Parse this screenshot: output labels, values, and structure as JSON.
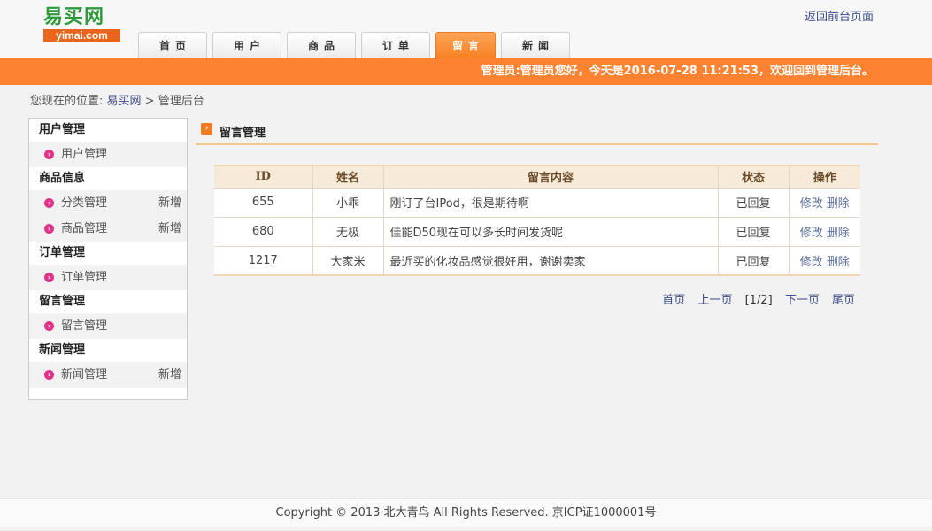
{
  "header": {
    "logo_cn": "易买网",
    "logo_en": "yimai.com",
    "back_link": "返回前台页面",
    "nav": [
      {
        "label": "首页"
      },
      {
        "label": "用户"
      },
      {
        "label": "商品"
      },
      {
        "label": "订单"
      },
      {
        "label": "留言",
        "active": true
      },
      {
        "label": "新闻"
      }
    ],
    "welcome": "管理员:管理员您好，今天是2016-07-28 11:21:53，欢迎回到管理后台。"
  },
  "breadcrumb": {
    "prefix": "您现在的位置:",
    "site": "易买网",
    "separator": ">",
    "current": "管理后台"
  },
  "sidebar": {
    "groups": [
      {
        "title": "用户管理",
        "items": [
          {
            "label": "用户管理",
            "add": ""
          }
        ]
      },
      {
        "title": "商品信息",
        "items": [
          {
            "label": "分类管理",
            "add": "新增"
          },
          {
            "label": "商品管理",
            "add": "新增"
          }
        ]
      },
      {
        "title": "订单管理",
        "items": [
          {
            "label": "订单管理",
            "add": ""
          }
        ]
      },
      {
        "title": "留言管理",
        "items": [
          {
            "label": "留言管理",
            "add": ""
          }
        ]
      },
      {
        "title": "新闻管理",
        "items": [
          {
            "label": "新闻管理",
            "add": "新增"
          }
        ]
      }
    ]
  },
  "main": {
    "title": "留言管理",
    "table": {
      "headers": [
        "ID",
        "姓名",
        "留言内容",
        "状态",
        "操作"
      ],
      "rows": [
        {
          "id": "655",
          "name": "小乖",
          "content": "刚订了台IPod，很是期待啊",
          "status": "已回复",
          "edit": "修改",
          "delete": "删除"
        },
        {
          "id": "680",
          "name": "无极",
          "content": "佳能D50现在可以多长时间发货呢",
          "status": "已回复",
          "edit": "修改",
          "delete": "删除"
        },
        {
          "id": "1217",
          "name": "大家米",
          "content": "最近买的化妆品感觉很好用，谢谢卖家",
          "status": "已回复",
          "edit": "修改",
          "delete": "删除"
        }
      ]
    },
    "pager": {
      "first": "首页",
      "prev": "上一页",
      "current": "[1/2]",
      "next": "下一页",
      "last": "尾页"
    }
  },
  "footer": {
    "text": "Copyright © 2013 北大青鸟 All Rights Reserved. 京ICP证1000001号"
  },
  "colors": {
    "accent_orange": "#fd8232",
    "logo_green": "#2f9a3c",
    "bullet_pink": "#e0338a"
  }
}
